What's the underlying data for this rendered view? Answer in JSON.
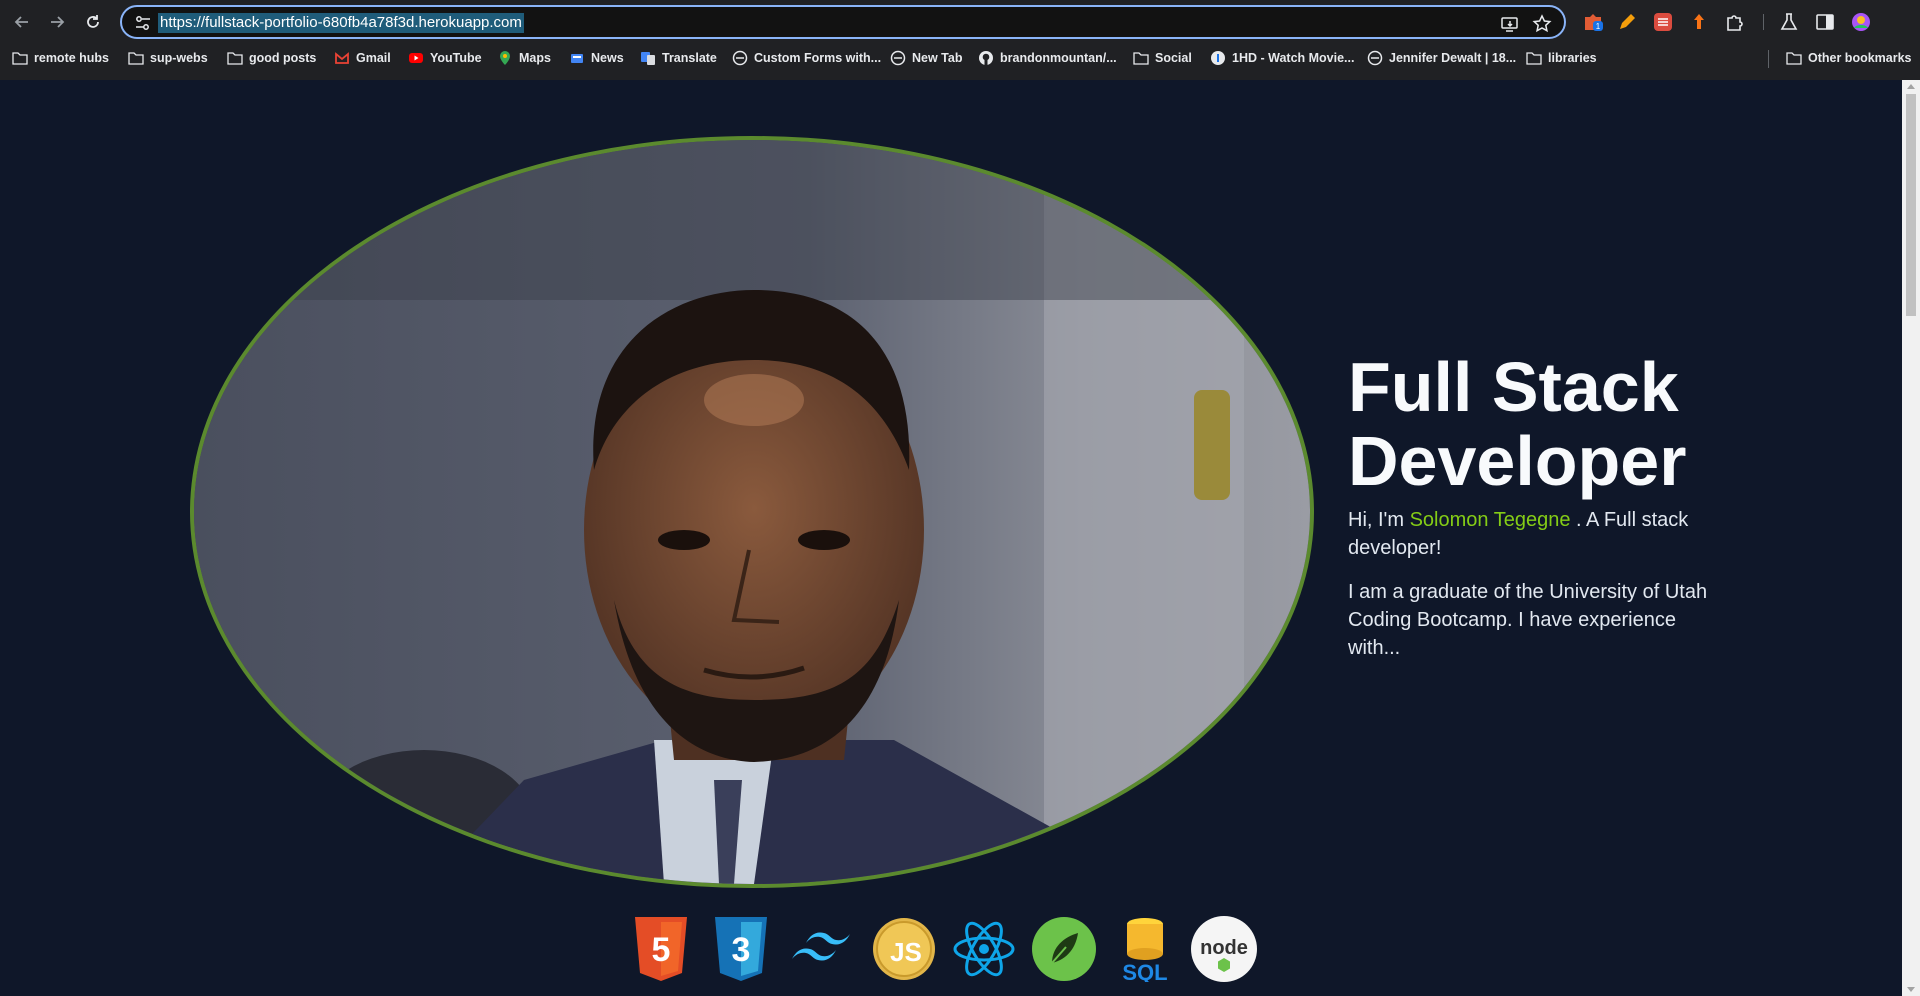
{
  "browser": {
    "url": "https://fullstack-portfolio-680fb4a78f3d.herokuapp.com",
    "extension_badge": "1",
    "bookmarks": [
      {
        "label": "remote hubs",
        "icon": "folder-icon"
      },
      {
        "label": "sup-webs",
        "icon": "folder-icon"
      },
      {
        "label": "good posts",
        "icon": "folder-icon"
      },
      {
        "label": "Gmail",
        "icon": "gmail-icon"
      },
      {
        "label": "YouTube",
        "icon": "youtube-icon"
      },
      {
        "label": "Maps",
        "icon": "maps-icon"
      },
      {
        "label": "News",
        "icon": "news-icon"
      },
      {
        "label": "Translate",
        "icon": "translate-icon"
      },
      {
        "label": "Custom Forms with...",
        "icon": "globe-icon"
      },
      {
        "label": "New Tab",
        "icon": "globe-icon"
      },
      {
        "label": "brandonmountan/...",
        "icon": "github-icon"
      },
      {
        "label": "Social",
        "icon": "folder-icon"
      },
      {
        "label": "1HD - Watch Movie...",
        "icon": "site-icon"
      },
      {
        "label": "Jennifer Dewalt | 18...",
        "icon": "globe-icon"
      },
      {
        "label": "libraries",
        "icon": "folder-icon"
      }
    ],
    "other_bookmarks": "Other bookmarks"
  },
  "hero": {
    "title_line1": "Full Stack",
    "title_line2": "Developer",
    "intro_prefix": "Hi, I'm ",
    "name": "Solomon Tegegne",
    "intro_suffix": " . A Full stack developer!",
    "bio": "I am a graduate of the University of Utah Coding Bootcamp. I have experience with..."
  },
  "tech_icons": [
    {
      "name": "html5-icon",
      "label": "5"
    },
    {
      "name": "css3-icon",
      "label": "3"
    },
    {
      "name": "tailwind-icon",
      "label": ""
    },
    {
      "name": "javascript-icon",
      "label": "JS"
    },
    {
      "name": "react-icon",
      "label": ""
    },
    {
      "name": "mongodb-leaf-icon",
      "label": ""
    },
    {
      "name": "sql-icon",
      "label": "SQL"
    },
    {
      "name": "nodejs-icon",
      "label": "node"
    }
  ],
  "colors": {
    "page_bg": "#0f1729",
    "accent": "#84cc16",
    "portrait_border": "#5b8a2e",
    "chrome_bg": "#202124",
    "omnibox_border": "#8ab4f8"
  }
}
